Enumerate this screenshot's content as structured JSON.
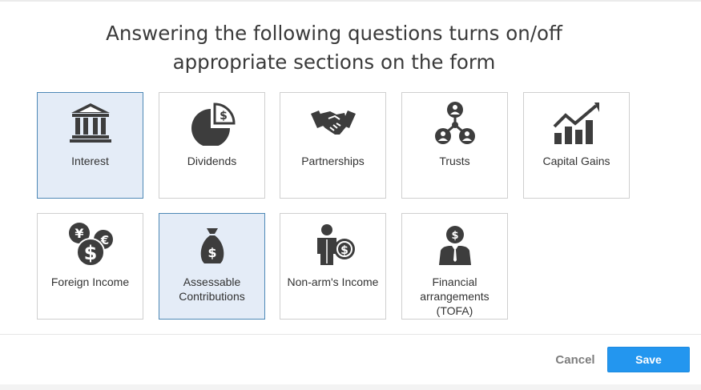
{
  "dialog": {
    "title_line1": "Answering the following questions turns on/off",
    "title_line2": "appropriate sections on the form"
  },
  "tiles": [
    {
      "label": "Interest",
      "icon": "bank-icon",
      "selected": true
    },
    {
      "label": "Dividends",
      "icon": "pie-chart-dollar-icon",
      "selected": false
    },
    {
      "label": "Partnerships",
      "icon": "handshake-icon",
      "selected": false
    },
    {
      "label": "Trusts",
      "icon": "people-network-icon",
      "selected": false
    },
    {
      "label": "Capital Gains",
      "icon": "growth-chart-icon",
      "selected": false
    },
    {
      "label": "Foreign Income",
      "icon": "currency-coins-icon",
      "selected": false
    },
    {
      "label": "Assessable Contributions",
      "icon": "money-bag-icon",
      "selected": true
    },
    {
      "label": "Non-arm's Income",
      "icon": "person-dollar-icon",
      "selected": false
    },
    {
      "label": "Financial arrangements (TOFA)",
      "icon": "businessman-dollar-icon",
      "selected": false
    }
  ],
  "footer": {
    "cancel_label": "Cancel",
    "save_label": "Save"
  },
  "colors": {
    "icon": "#3d3d3d",
    "selected_bg": "#e4ecf7",
    "selected_border": "#4d88b6",
    "save_bg": "#2396ef",
    "cancel_text": "#7d7d7d"
  }
}
